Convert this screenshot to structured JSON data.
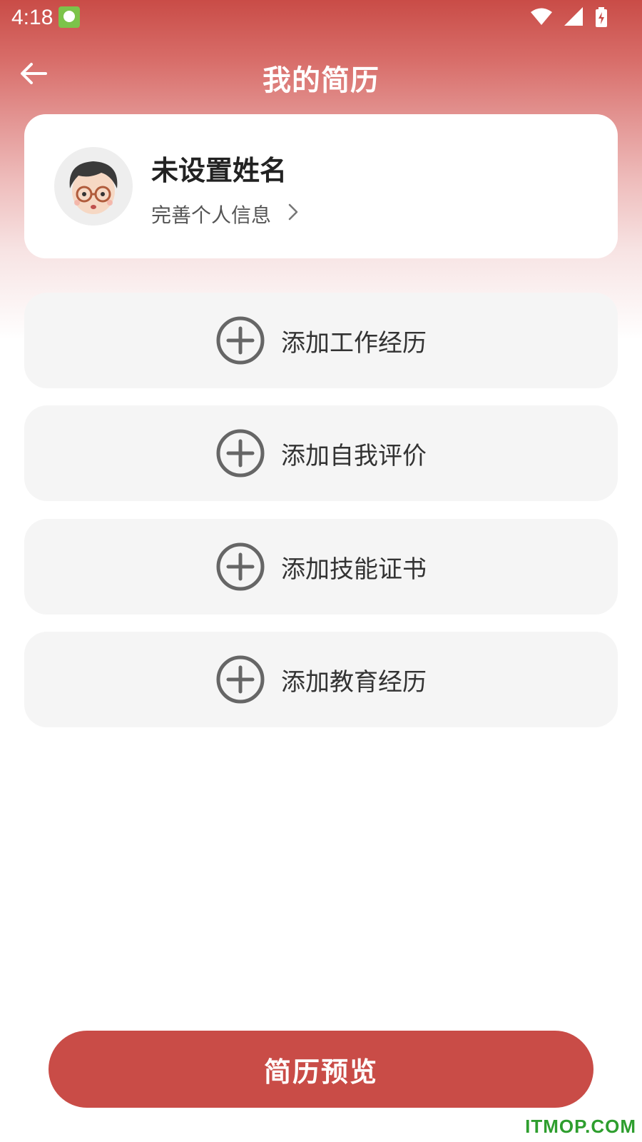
{
  "status_bar": {
    "time": "4:18",
    "icons": [
      "app-notification-icon",
      "wifi-icon",
      "signal-icon",
      "battery-charging-icon"
    ]
  },
  "header": {
    "title": "我的简历",
    "back_icon": "arrow-left-icon"
  },
  "profile": {
    "name": "未设置姓名",
    "subtitle": "完善个人信息",
    "chevron_icon": "chevron-right-icon",
    "avatar_icon": "cartoon-avatar-icon"
  },
  "sections": [
    {
      "label": "添加工作经历",
      "icon": "plus-circle-icon"
    },
    {
      "label": "添加自我评价",
      "icon": "plus-circle-icon"
    },
    {
      "label": "添加技能证书",
      "icon": "plus-circle-icon"
    },
    {
      "label": "添加教育经历",
      "icon": "plus-circle-icon"
    }
  ],
  "footer": {
    "preview_label": "简历预览"
  },
  "watermark": "ITMOP.COM",
  "colors": {
    "accent": "#c94c47",
    "card_bg": "#f5f5f5",
    "watermark": "#2e9e2e"
  }
}
